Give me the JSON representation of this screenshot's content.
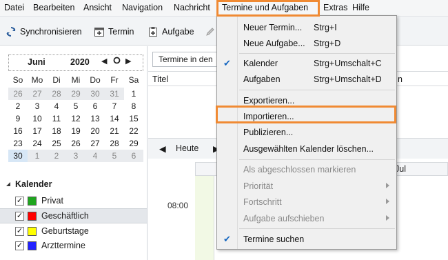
{
  "menubar": {
    "items": [
      {
        "label": "Datei",
        "underline": "D"
      },
      {
        "label": "Bearbeiten",
        "underline": "B"
      },
      {
        "label": "Ansicht",
        "underline": "A"
      },
      {
        "label": "Navigation",
        "underline": "N"
      },
      {
        "label": "Nachricht",
        "underline": "N"
      },
      {
        "label": "Termine und Aufgaben",
        "underline": "T"
      },
      {
        "label": "Extras",
        "underline": "E"
      },
      {
        "label": "Hilfe",
        "underline": "H"
      }
    ]
  },
  "toolbar": {
    "sync_label": "Synchronisieren",
    "event_label": "Termin",
    "task_label": "Aufgabe"
  },
  "minicalendar": {
    "month": "Juni",
    "year": "2020",
    "weekdays": [
      "So",
      "Mo",
      "Di",
      "Mi",
      "Do",
      "Fr",
      "Sa"
    ],
    "weeks": [
      [
        "26",
        "27",
        "28",
        "29",
        "30",
        "31",
        "1"
      ],
      [
        "2",
        "3",
        "4",
        "5",
        "6",
        "7",
        "8"
      ],
      [
        "9",
        "10",
        "11",
        "12",
        "13",
        "14",
        "15"
      ],
      [
        "16",
        "17",
        "18",
        "19",
        "20",
        "21",
        "22"
      ],
      [
        "23",
        "24",
        "25",
        "26",
        "27",
        "28",
        "29"
      ],
      [
        "30",
        "1",
        "2",
        "3",
        "4",
        "5",
        "6"
      ]
    ]
  },
  "calendars": {
    "title": "Kalender",
    "items": [
      {
        "name": "Privat",
        "color": "#1fa51f",
        "checked": true
      },
      {
        "name": "Geschäftlich",
        "color": "#ff0000",
        "checked": true
      },
      {
        "name": "Geburtstage",
        "color": "#ffff00",
        "checked": true
      },
      {
        "name": "Arzttermine",
        "color": "#2222ff",
        "checked": true
      }
    ]
  },
  "events": {
    "filter_value": "Termine in den",
    "column_title": "Titel",
    "column_right": "n"
  },
  "dayview": {
    "today_label": "Heute",
    "day_header": "Jul",
    "time_label": "08:00"
  },
  "dropdown": {
    "items": [
      {
        "label": "Neuer Termin...",
        "shortcut": "Strg+I",
        "checked": false,
        "submenu": false,
        "disabled": false
      },
      {
        "label": "Neue Aufgabe...",
        "shortcut": "Strg+D",
        "checked": false,
        "submenu": false,
        "disabled": false
      },
      {
        "label": "Kalender",
        "shortcut": "Strg+Umschalt+C",
        "checked": true,
        "submenu": false,
        "disabled": false
      },
      {
        "label": "Aufgaben",
        "shortcut": "Strg+Umschalt+D",
        "checked": false,
        "submenu": false,
        "disabled": false
      },
      {
        "label": "Exportieren...",
        "shortcut": "",
        "checked": false,
        "submenu": false,
        "disabled": false
      },
      {
        "label": "Importieren...",
        "shortcut": "",
        "checked": false,
        "submenu": false,
        "disabled": false
      },
      {
        "label": "Publizieren...",
        "shortcut": "",
        "checked": false,
        "submenu": false,
        "disabled": false
      },
      {
        "label": "Ausgewählten Kalender löschen...",
        "shortcut": "",
        "checked": false,
        "submenu": false,
        "disabled": false
      },
      {
        "label": "Als abgeschlossen markieren",
        "shortcut": "",
        "checked": false,
        "submenu": false,
        "disabled": true
      },
      {
        "label": "Priorität",
        "shortcut": "",
        "checked": false,
        "submenu": true,
        "disabled": true
      },
      {
        "label": "Fortschritt",
        "shortcut": "",
        "checked": false,
        "submenu": true,
        "disabled": true
      },
      {
        "label": "Aufgabe aufschieben",
        "shortcut": "",
        "checked": false,
        "submenu": true,
        "disabled": true
      },
      {
        "label": "Termine suchen",
        "shortcut": "",
        "checked": true,
        "submenu": false,
        "disabled": false
      }
    ]
  },
  "colors": {
    "highlight": "#f08a33",
    "check": "#1466c0",
    "today_bg": "#d7e7f6",
    "day_bg": "#f2f9e5"
  }
}
